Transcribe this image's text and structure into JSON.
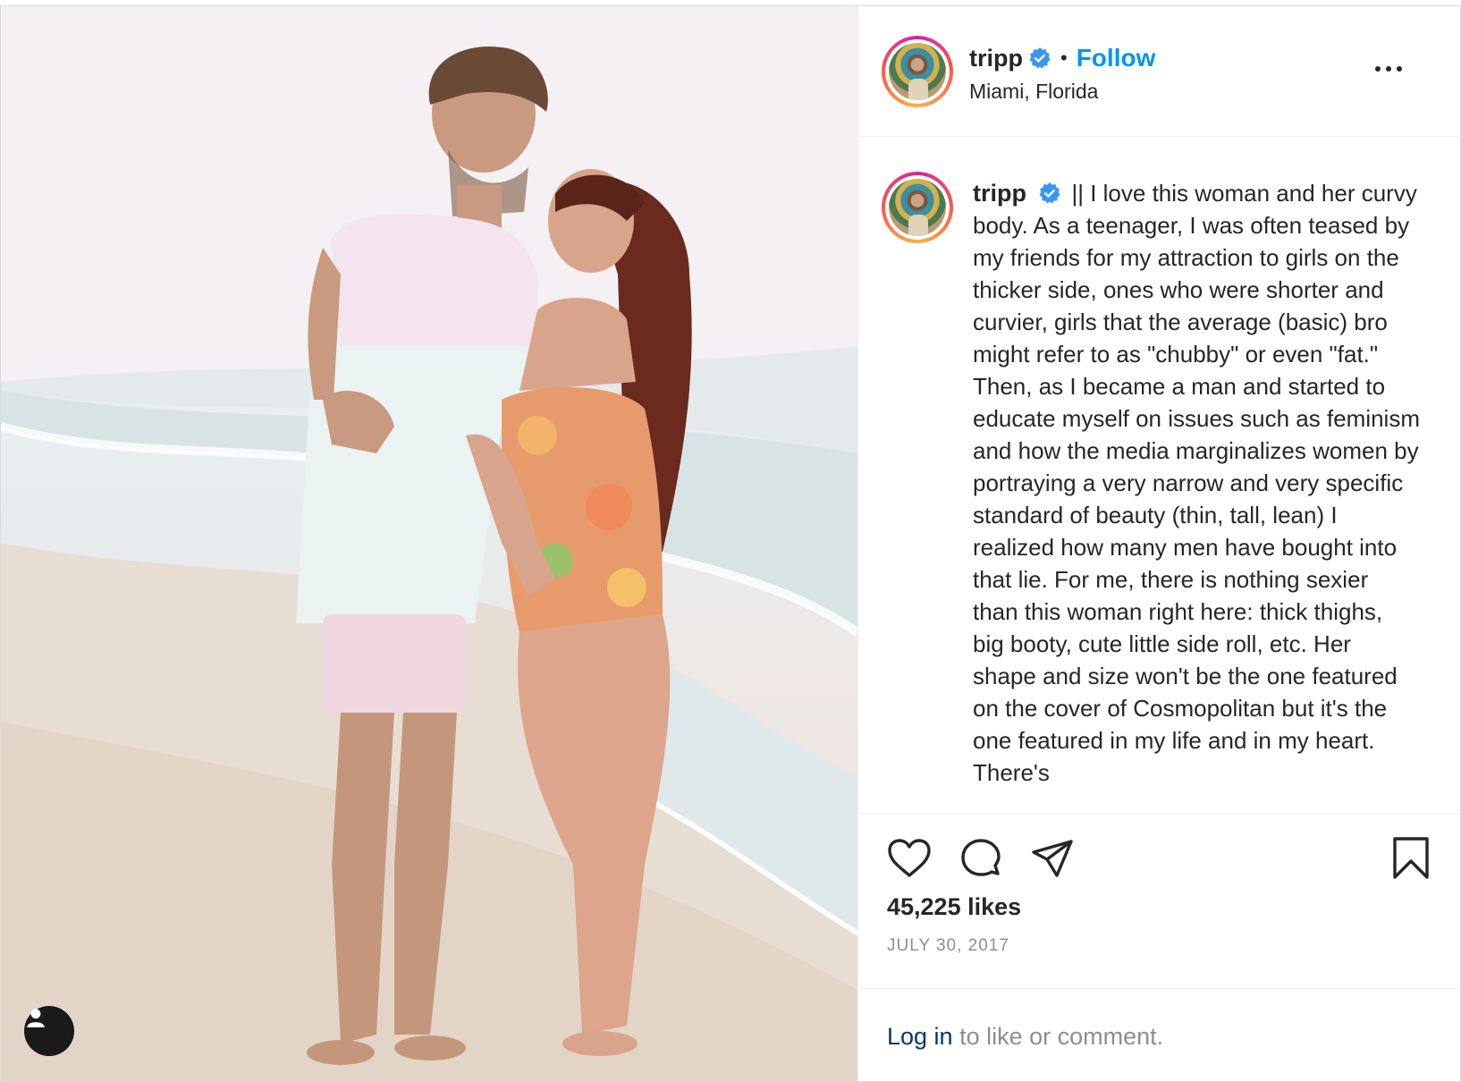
{
  "post": {
    "username": "tripp",
    "verified": true,
    "separator": "•",
    "follow_label": "Follow",
    "location": "Miami, Florida",
    "more_icon": "more-horizontal-icon"
  },
  "caption": {
    "username": "tripp",
    "text": "|| I love this woman and her curvy body. As a teenager, I was often teased by my friends for my attraction to girls on the thicker side, ones who were shorter and curvier, girls that the average (basic) bro might refer to as \"chubby\" or even \"fat.\" Then, as I became a man and started to educate myself on issues such as feminism and how the media marginalizes women by portraying a very narrow and very specific standard of beauty (thin, tall, lean) I realized how many men have bought into that lie. For me, there is nothing sexier than this woman right here: thick thighs, big booty, cute little side roll, etc. Her shape and size won't be the one featured on the cover of Cosmopolitan but it's the one featured in my life and in my heart. There's"
  },
  "actions": {
    "like_icon": "heart-icon",
    "comment_icon": "comment-bubble-icon",
    "share_icon": "paper-plane-icon",
    "save_icon": "bookmark-icon",
    "likes": "45,225 likes",
    "date": "JULY 30, 2017"
  },
  "login": {
    "link_label": "Log in",
    "suffix": " to like or comment."
  },
  "colors": {
    "accent": "#0095f6",
    "verified": "#3897f0",
    "secondary_text": "#8e8e8e",
    "link_dark": "#00376b"
  }
}
